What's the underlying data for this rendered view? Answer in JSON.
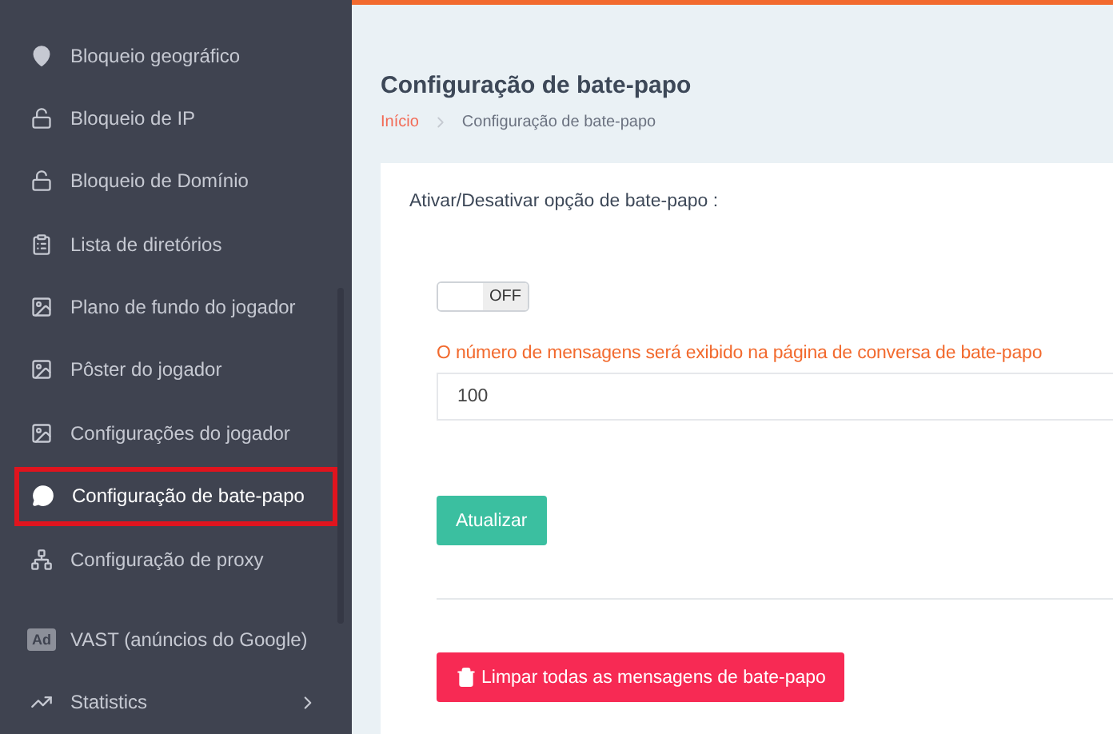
{
  "sidebar": {
    "items": [
      {
        "kind": "pin",
        "label": "Bloqueio geográfico",
        "selected": false
      },
      {
        "kind": "lock",
        "label": "Bloqueio de IP",
        "selected": false
      },
      {
        "kind": "lock",
        "label": "Bloqueio de Domínio",
        "selected": false
      },
      {
        "kind": "clipboard",
        "label": "Lista de diretórios",
        "selected": false
      },
      {
        "kind": "image",
        "label": "Plano de fundo do jogador",
        "selected": false
      },
      {
        "kind": "image",
        "label": "Pôster do jogador",
        "selected": false
      },
      {
        "kind": "image",
        "label": "Configurações do jogador",
        "selected": false
      },
      {
        "kind": "chat",
        "label": "Configuração de bate-papo",
        "selected": true
      },
      {
        "kind": "network",
        "label": "Configuração de proxy",
        "selected": false
      },
      {
        "kind": "ad",
        "badge": "Ad",
        "label": "VAST (anúncios do Google)",
        "selected": false
      },
      {
        "kind": "chart",
        "label": "Statistics",
        "selected": false,
        "expandable": true
      }
    ]
  },
  "page": {
    "title": "Configuração de bate-papo",
    "breadcrumb": [
      "Início",
      "Configuração de bate-papo"
    ]
  },
  "form": {
    "toggle_label": "Ativar/Desativar opção de bate-papo :",
    "toggle": {
      "on": false,
      "text": "OFF"
    },
    "count_label": "O número de mensagens será exibido na página de conversa de bate-papo",
    "count_value": "100",
    "submit": "Atualizar",
    "clear": "Limpar todas as mensagens de bate-papo"
  }
}
